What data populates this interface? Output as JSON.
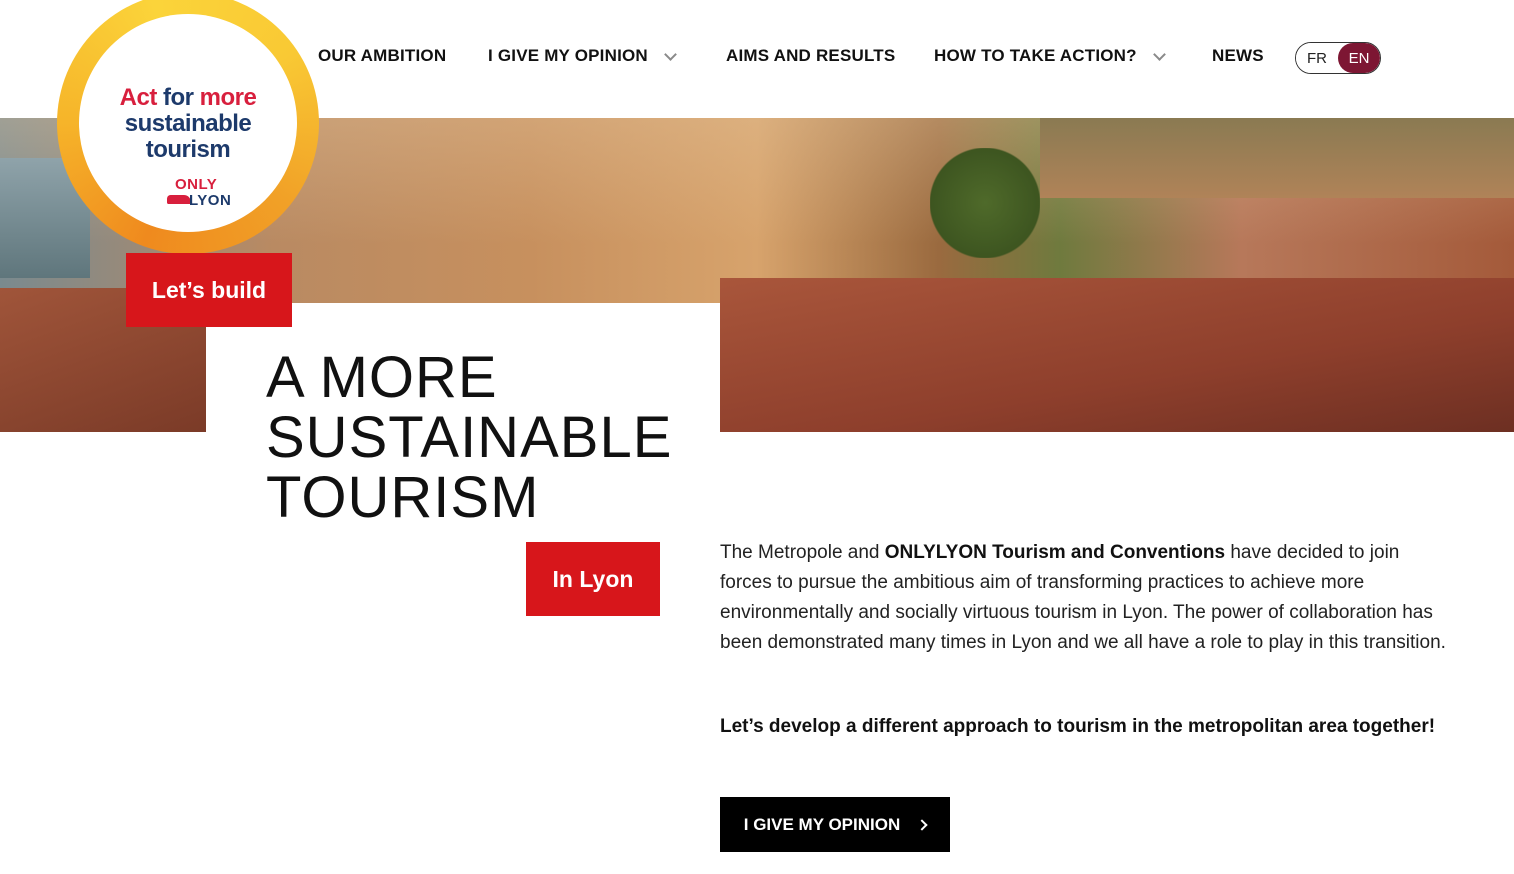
{
  "nav": {
    "items": [
      {
        "label": "OUR AMBITION"
      },
      {
        "label": "I GIVE MY OPINION"
      },
      {
        "label": "AIMS AND RESULTS"
      },
      {
        "label": "HOW TO TAKE ACTION?"
      },
      {
        "label": "NEWS"
      }
    ],
    "lang": {
      "fr": "FR",
      "en": "EN"
    }
  },
  "badge": {
    "line1_red": "Act",
    "line1_blue": "for",
    "line1_red2": "more",
    "line2": "sustainable",
    "line3": "tourism",
    "brand_top": "ONLY",
    "brand_bottom": "LYON"
  },
  "hero": {
    "tag_top": "Let’s build",
    "title_lines": [
      "A MORE",
      "SUSTAINABLE",
      "TOURISM"
    ],
    "tag_bottom": "In Lyon"
  },
  "content": {
    "intro_before": "The Metropole and ",
    "intro_bold": "ONLYLYON Tourism and Conventions",
    "intro_after": " have decided to join forces to pursue the ambitious aim of transforming practices to achieve more environmentally and socially virtuous tourism in Lyon. The power of collaboration has been demonstrated many times in Lyon and we all have a role to play in this transition.",
    "lead": "Let’s develop a different approach to tourism in the metropolitan area together!",
    "cta": "I GIVE MY OPINION"
  },
  "colors": {
    "accent_red": "#d7161b",
    "lang_active": "#7d1633",
    "brand_blue": "#1d3a6b"
  }
}
